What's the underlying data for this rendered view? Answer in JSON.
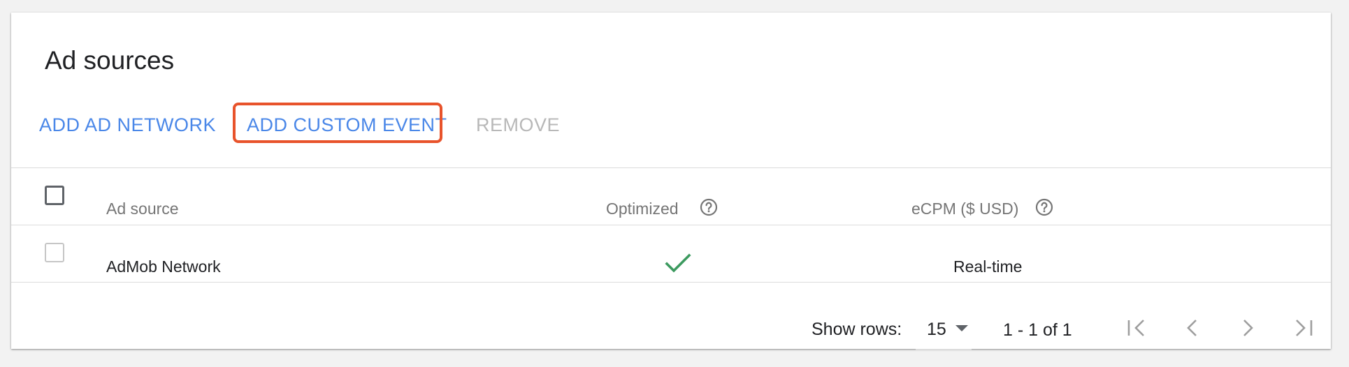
{
  "title": "Ad sources",
  "toolbar": {
    "add_ad_network": "ADD AD NETWORK",
    "add_custom_event": "ADD CUSTOM EVENT",
    "remove": "REMOVE"
  },
  "table": {
    "columns": {
      "ad_source": "Ad source",
      "optimized": "Optimized",
      "ecpm": "eCPM ($ USD)"
    },
    "rows": [
      {
        "name": "AdMob Network",
        "optimized": true,
        "ecpm": "Real-time",
        "selected": false
      }
    ]
  },
  "pagination": {
    "show_rows_label": "Show rows:",
    "rows_per_page": "15",
    "range": "1 - 1 of 1"
  },
  "colors": {
    "accent": "#4a87e8",
    "disabled": "#b8b8b8",
    "highlight": "#e8532b",
    "check": "#3c9a5f"
  },
  "icons": {
    "help": "help-circle-icon",
    "check": "checkmark-icon",
    "first_page": "first-page-icon",
    "prev_page": "chevron-left-icon",
    "next_page": "chevron-right-icon",
    "last_page": "last-page-icon",
    "dropdown": "dropdown-arrow-icon"
  }
}
